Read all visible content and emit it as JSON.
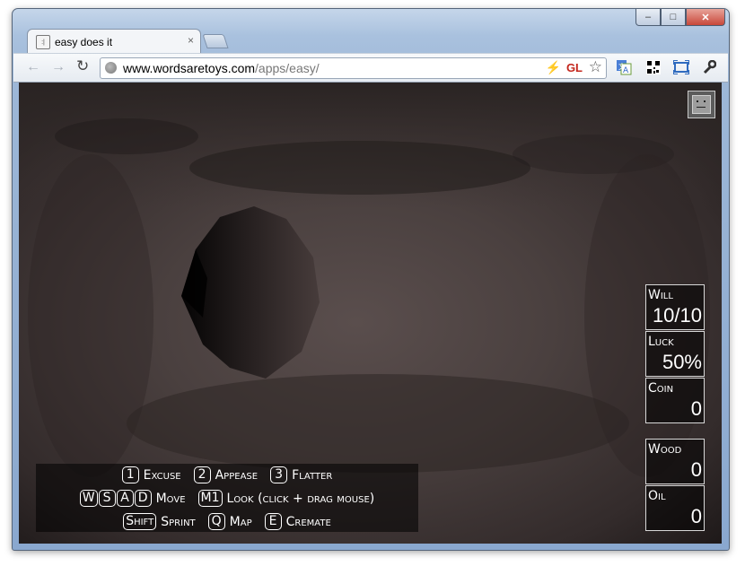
{
  "browser": {
    "tab_title": "easy does it",
    "tab_close": "×",
    "url_host": "www.wordsaretoys.com",
    "url_path": "/apps/easy/",
    "gl_badge": "GL",
    "caption": {
      "minimize": "–",
      "maximize": "□",
      "close": "✕"
    },
    "nav": {
      "back": "←",
      "forward": "→",
      "reload": "↻"
    },
    "toolbar_icons": [
      "translate-icon",
      "qr-code-icon",
      "fullscreen-icon",
      "wrench-icon"
    ]
  },
  "game": {
    "stats": [
      {
        "label": "Will",
        "value": "10/10"
      },
      {
        "label": "Luck",
        "value": "50%"
      },
      {
        "label": "Coin",
        "value": "0"
      }
    ],
    "inventory": [
      {
        "label": "Wood",
        "value": "0"
      },
      {
        "label": "Oil",
        "value": "0"
      }
    ],
    "controls": {
      "row1": [
        {
          "key": "1",
          "action": "Excuse"
        },
        {
          "key": "2",
          "action": "Appease"
        },
        {
          "key": "3",
          "action": "Flatter"
        }
      ],
      "row2": {
        "keys": [
          "W",
          "S",
          "A",
          "D"
        ],
        "move": "Move",
        "m1_key": "M1",
        "look": "Look (click + drag mouse)"
      },
      "row3": [
        {
          "key": "Shift",
          "action": "Sprint"
        },
        {
          "key": "Q",
          "action": "Map"
        },
        {
          "key": "E",
          "action": "Cremate"
        }
      ]
    }
  },
  "colors": {
    "stat_border": "#d8d8d8",
    "tunnel": "#3a3231",
    "gl_red": "#c3261c"
  }
}
